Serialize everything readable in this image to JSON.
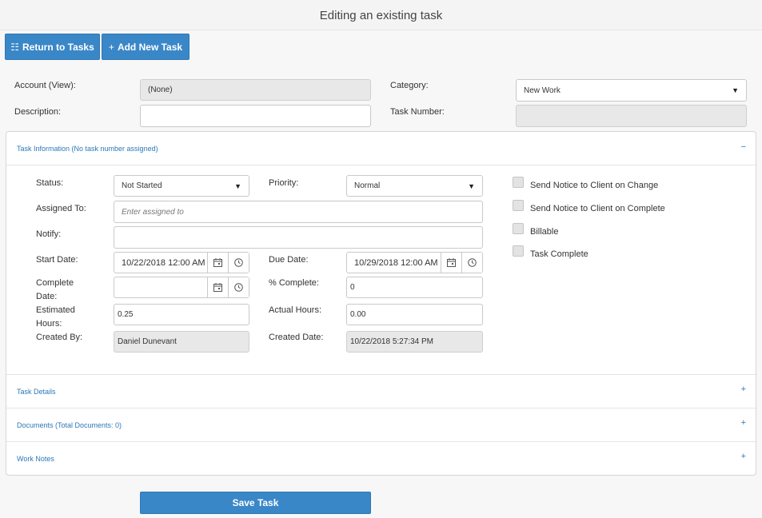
{
  "page": {
    "title": "Editing an existing task"
  },
  "toolbar": {
    "return_label": "Return to Tasks",
    "add_label": "Add New Task"
  },
  "header_form": {
    "account_label": "Account (View):",
    "account_value": "(None)",
    "description_label": "Description:",
    "description_value": "",
    "category_label": "Category:",
    "category_value": "New Work",
    "task_number_label": "Task Number:",
    "task_number_value": ""
  },
  "sections": {
    "task_info": {
      "title": "Task Information (No task number assigned)",
      "toggle": "−"
    },
    "task_details": {
      "title": "Task Details",
      "toggle": "+"
    },
    "documents": {
      "title": "Documents (Total Documents: 0)",
      "toggle": "+"
    },
    "work_notes": {
      "title": "Work Notes",
      "toggle": "+"
    }
  },
  "task_form": {
    "status_label": "Status:",
    "status_value": "Not Started",
    "priority_label": "Priority:",
    "priority_value": "Normal",
    "assigned_label": "Assigned To:",
    "assigned_placeholder": "Enter assigned to",
    "notify_label": "Notify:",
    "notify_value": "",
    "start_date_label": "Start Date:",
    "start_date_value": "10/22/2018 12:00 AM",
    "due_date_label": "Due Date:",
    "due_date_value": "10/29/2018 12:00 AM",
    "complete_date_label_1": "Complete",
    "complete_date_label_2": "Date:",
    "complete_date_value": "",
    "pct_complete_label": "% Complete:",
    "pct_complete_value": "0",
    "est_hours_label_1": "Estimated",
    "est_hours_label_2": "Hours:",
    "est_hours_value": "0.25",
    "actual_hours_label": "Actual Hours:",
    "actual_hours_value": "0.00",
    "created_by_label": "Created By:",
    "created_by_value": "Daniel Dunevant",
    "created_date_label": "Created Date:",
    "created_date_value": "10/22/2018 5:27:34 PM"
  },
  "checkboxes": [
    {
      "label": "Send Notice to Client on Change",
      "checked": false
    },
    {
      "label": "Send Notice to Client on Complete",
      "checked": false
    },
    {
      "label": "Billable",
      "checked": false
    },
    {
      "label": "Task Complete",
      "checked": false
    }
  ],
  "footer": {
    "save_label": "Save Task"
  },
  "colors": {
    "accent": "#3a87c8",
    "link": "#2c78b8"
  },
  "icons": [
    "list-check-icon",
    "plus-icon",
    "caret-down-icon",
    "calendar-icon",
    "clock-icon",
    "minus-icon"
  ]
}
